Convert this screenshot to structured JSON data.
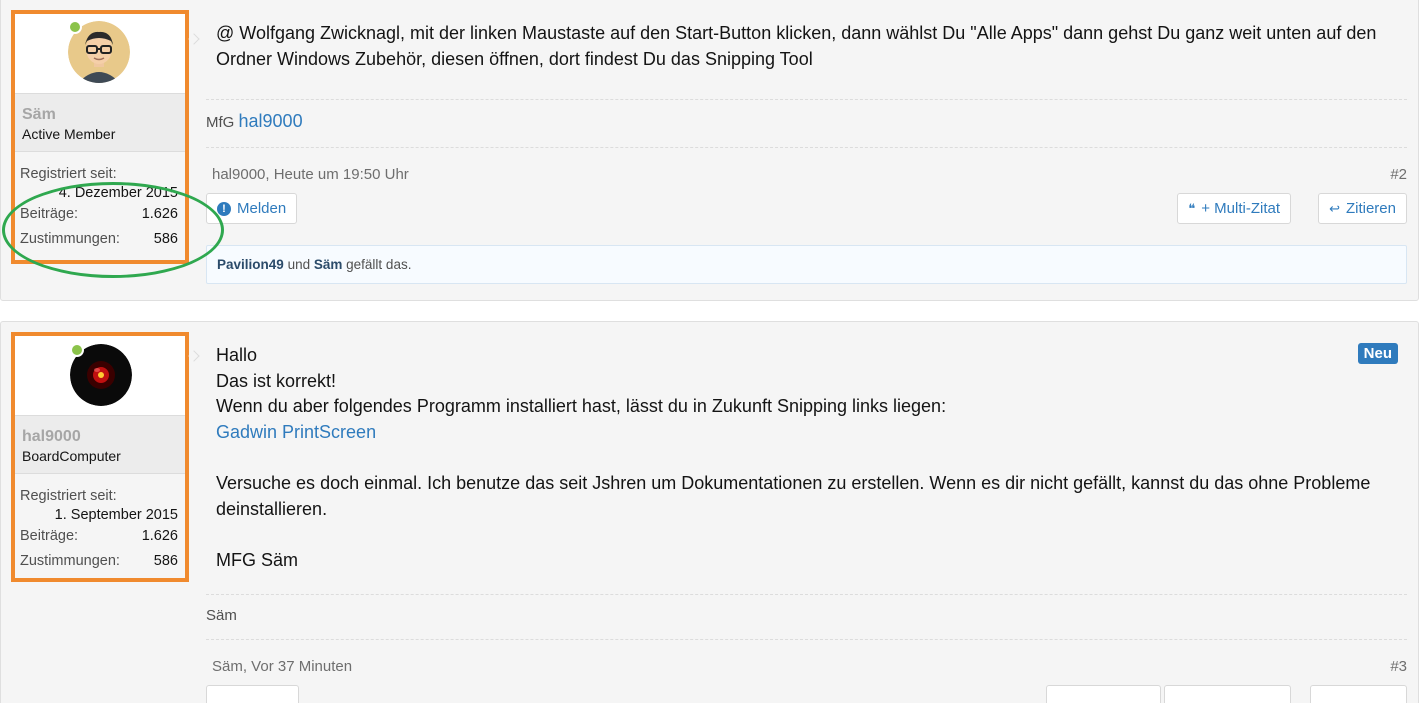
{
  "posts": [
    {
      "user": {
        "name": "Säm",
        "title": "Active Member",
        "registered_label": "Registriert seit:",
        "registered_date": "4. Dezember 2015",
        "posts_label": "Beiträge:",
        "posts_value": "1.626",
        "likes_label": "Zustimmungen:",
        "likes_value": "586"
      },
      "message": "@ Wolfgang Zwicknagl, mit der linken Maustaste auf den Start-Button klicken, dann wählst Du \"Alle Apps\" dann gehst Du ganz weit unten auf den Ordner Windows Zubehör, diesen öffnen, dort findest Du das Snipping Tool",
      "signature_prefix": "MfG",
      "signature_link": "hal9000",
      "meta_author_time": "hal9000, Heute um 19:50 Uhr",
      "post_number": "#2",
      "report_label": "Melden",
      "multiquote_label": "+ Multi-Zitat",
      "quote_label": "Zitieren",
      "likes_user1": "Pavilion49",
      "likes_and": "und",
      "likes_user2": "Säm",
      "likes_suffix": "gefällt das."
    },
    {
      "user": {
        "name": "hal9000",
        "title": "BoardComputer",
        "registered_label": "Registriert seit:",
        "registered_date": "1. September 2015",
        "posts_label": "Beiträge:",
        "posts_value": "1.626",
        "likes_label": "Zustimmungen:",
        "likes_value": "586"
      },
      "badge": "Neu",
      "message_lines": [
        "Hallo",
        "Das ist korrekt!",
        "Wenn du aber folgendes Programm installiert hast, lässt du in Zukunft Snipping links liegen:"
      ],
      "message_link": "Gadwin PrintScreen",
      "message_para2": "Versuche es doch einmal. Ich benutze das seit Jshren um Dokumentationen zu erstellen. Wenn es dir nicht gefällt, kannst du das ohne Probleme deinstallieren.",
      "message_closing": "MFG Säm",
      "signature": "Säm",
      "meta_author_time": "Säm, Vor 37 Minuten",
      "post_number": "#3"
    }
  ],
  "colors": {
    "highlight_box": "#f08a2e",
    "highlight_ellipse": "#2fa84f",
    "link": "#2f7bbd"
  }
}
